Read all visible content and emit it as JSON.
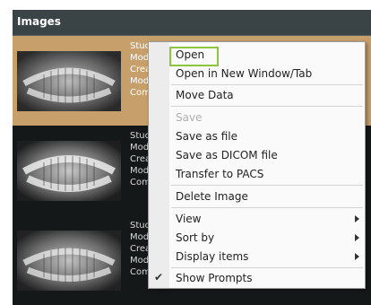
{
  "panel": {
    "title": "Images"
  },
  "images": [
    {
      "lines": [
        "Study",
        "Modality",
        "Created",
        "Modified",
        "Comment"
      ],
      "selected": true
    },
    {
      "lines": [
        "Study",
        "Modality",
        "Created",
        "Modified",
        "Comment"
      ],
      "selected": false
    },
    {
      "lines": [
        "Study",
        "Modality",
        "Created",
        "Modified",
        "Comment"
      ],
      "selected": false
    }
  ],
  "context_menu": {
    "items": [
      {
        "label": "Open",
        "state": "focused"
      },
      {
        "label": "Open in New Window/Tab"
      },
      {
        "label": "Move Data"
      },
      {
        "label": "Save",
        "state": "disabled"
      },
      {
        "label": "Save as file"
      },
      {
        "label": "Save as DICOM file"
      },
      {
        "label": "Transfer to PACS"
      },
      {
        "label": "Delete Image"
      },
      {
        "label": "View",
        "submenu": true
      },
      {
        "label": "Sort by",
        "submenu": true
      },
      {
        "label": "Display items",
        "submenu": true
      },
      {
        "label": "Show Prompts",
        "checked": true
      }
    ],
    "check_glyph": "✔"
  },
  "colors": {
    "panel_header": "#3a4346",
    "panel_background": "#1a1d1e",
    "selected_row": "#c79f6b",
    "focus_outline": "#8cc63f"
  }
}
